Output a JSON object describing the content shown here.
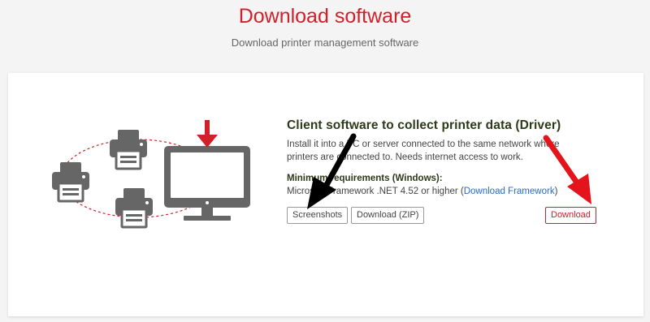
{
  "header": {
    "title": "Download software",
    "subtitle": "Download printer management software"
  },
  "card": {
    "heading": "Client software to collect printer data (Driver)",
    "description": "Install it into a PC or server connected to the same network where printers are connected to. Needs internet access to work.",
    "requirements_title": "Minimum requirements (Windows):",
    "requirements_text": "Microsoft Framework .NET 4.52 or higher (",
    "requirements_link": "Download Framework",
    "requirements_suffix": ")",
    "buttons": {
      "screenshots": "Screenshots",
      "download_zip": "Download (ZIP)",
      "download": "Download"
    }
  },
  "colors": {
    "accent": "#d0202a",
    "link": "#2a6cc9",
    "icon_gray": "#666666"
  },
  "icons": [
    "printer-icon",
    "monitor-icon",
    "download-arrow-icon"
  ]
}
